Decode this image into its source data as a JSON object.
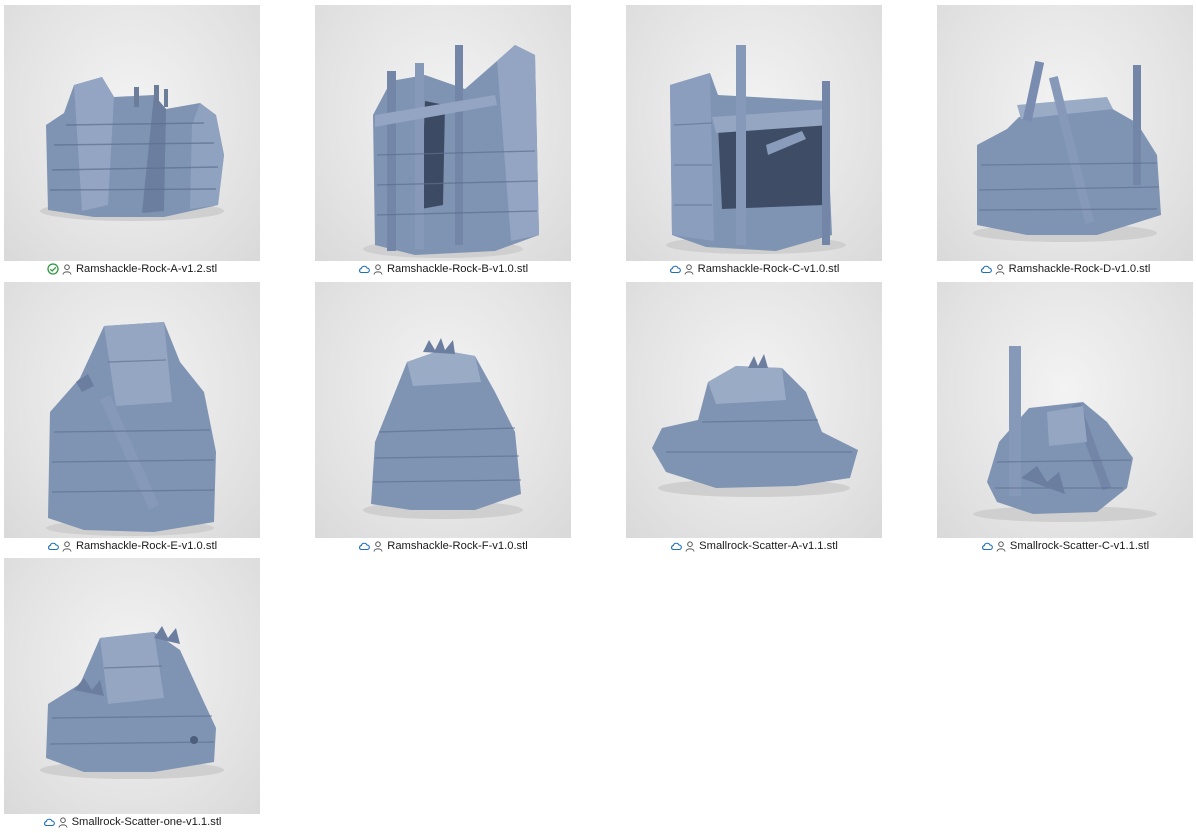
{
  "window": {
    "view": "large-icons"
  },
  "colors": {
    "cloud": "#1e6fb9",
    "synced": "#2c9a3c",
    "model": "#7f93b3",
    "model_dark": "#5d6f8d",
    "model_light": "#a3b2cb"
  },
  "files": [
    {
      "name": "Ramshackle-Rock-A-v1.2.stl",
      "status": "synced",
      "status_icon": "check-circle-icon",
      "owner_icon": "person-icon",
      "shape": "A"
    },
    {
      "name": "Ramshackle-Rock-B-v1.0.stl",
      "status": "cloud",
      "status_icon": "cloud-icon",
      "owner_icon": "person-icon",
      "shape": "B"
    },
    {
      "name": "Ramshackle-Rock-C-v1.0.stl",
      "status": "cloud",
      "status_icon": "cloud-icon",
      "owner_icon": "person-icon",
      "shape": "C"
    },
    {
      "name": "Ramshackle-Rock-D-v1.0.stl",
      "status": "cloud",
      "status_icon": "cloud-icon",
      "owner_icon": "person-icon",
      "shape": "D"
    },
    {
      "name": "Ramshackle-Rock-E-v1.0.stl",
      "status": "cloud",
      "status_icon": "cloud-icon",
      "owner_icon": "person-icon",
      "shape": "E"
    },
    {
      "name": "Ramshackle-Rock-F-v1.0.stl",
      "status": "cloud",
      "status_icon": "cloud-icon",
      "owner_icon": "person-icon",
      "shape": "F"
    },
    {
      "name": "Smallrock-Scatter-A-v1.1.stl",
      "status": "cloud",
      "status_icon": "cloud-icon",
      "owner_icon": "person-icon",
      "shape": "G"
    },
    {
      "name": "Smallrock-Scatter-C-v1.1.stl",
      "status": "cloud",
      "status_icon": "cloud-icon",
      "owner_icon": "person-icon",
      "shape": "H"
    },
    {
      "name": "Smallrock-Scatter-one-v1.1.stl",
      "status": "cloud",
      "status_icon": "cloud-icon",
      "owner_icon": "person-icon",
      "shape": "I"
    }
  ]
}
